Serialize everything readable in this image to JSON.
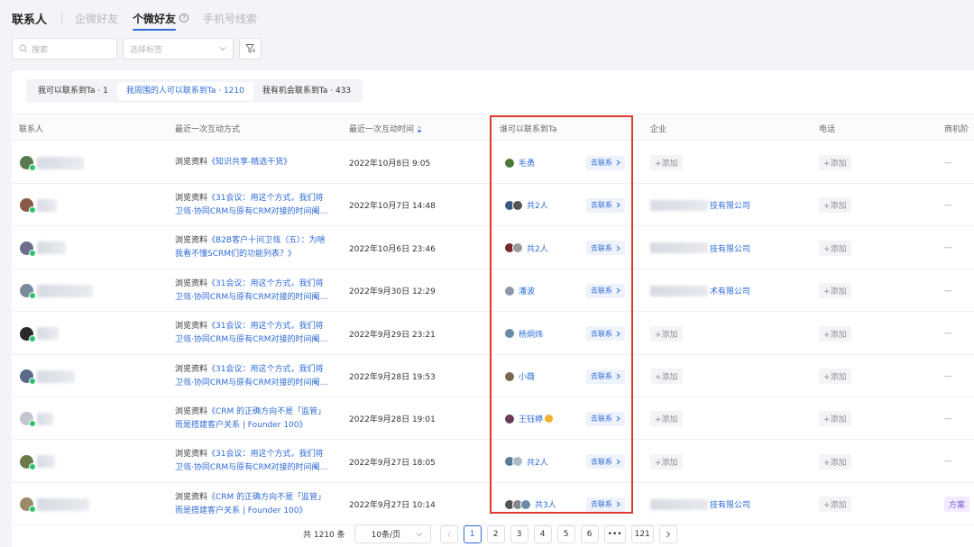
{
  "header": {
    "title": "联系人",
    "tabs": [
      {
        "label": "企微好友"
      },
      {
        "label": "个微好友"
      },
      {
        "label": "手机号线索"
      }
    ],
    "help_icon": "?"
  },
  "filters": {
    "search_placeholder": "搜索",
    "tag_placeholder": "选择标签"
  },
  "segments": [
    {
      "label": "我可以联系到Ta · 1"
    },
    {
      "label": "我周围的人可以联系到Ta · 1210"
    },
    {
      "label": "我有机会联系到Ta · 433"
    }
  ],
  "columns": {
    "contact": "联系人",
    "interaction": "最近一次互动方式",
    "time": "最近一次互动时间",
    "reach": "谁可以联系到Ta",
    "company": "企业",
    "phone": "电话",
    "stage": "商机阶"
  },
  "labels": {
    "contact_button": "去联系",
    "add": "+添加",
    "dash": "—",
    "browse_prefix": "浏览资料"
  },
  "rows": [
    {
      "line1": "《知识共享-精选干货》",
      "line2": "",
      "time": "2022年10月8日 9:05",
      "reach": "毛勇",
      "company": "",
      "stage": "—"
    },
    {
      "line1": "《31会议：用这个方式，我们将",
      "line2": "卫瓴·协同CRM与原有CRM对接的时间阉…",
      "time": "2022年10月7日 14:48",
      "reach": "共2人",
      "company": "技有限公司",
      "stage": "—"
    },
    {
      "line1": "《B2B客户十问卫瓴（五）：为啥",
      "line2": "我看不懂SCRM们的功能列表？》",
      "time": "2022年10月6日 23:46",
      "reach": "共2人",
      "company": "技有限公司",
      "stage": "—"
    },
    {
      "line1": "《31会议：用这个方式，我们将",
      "line2": "卫瓴·协同CRM与原有CRM对接的时间阉…",
      "time": "2022年9月30日 12:29",
      "reach": "潘波",
      "company": "术有限公司",
      "stage": "—"
    },
    {
      "line1": "《31会议：用这个方式，我们将",
      "line2": "卫瓴·协同CRM与原有CRM对接的时间阉…",
      "time": "2022年9月29日 23:21",
      "reach": "杨炯炜",
      "company": "",
      "stage": "—"
    },
    {
      "line1": "《31会议：用这个方式，我们将",
      "line2": "卫瓴·协同CRM与原有CRM对接的时间阉…",
      "time": "2022年9月28日 19:53",
      "reach": "小薇",
      "company": "",
      "stage": "—"
    },
    {
      "line1": "《CRM 的正确方向不是「监管」",
      "line2": "而是搭建客户关系 | Founder 100》",
      "time": "2022年9月28日 19:01",
      "reach": "王钰婷",
      "company": "",
      "stage": "—"
    },
    {
      "line1": "《31会议：用这个方式，我们将",
      "line2": "卫瓴·协同CRM与原有CRM对接的时间阉…",
      "time": "2022年9月27日 18:05",
      "reach": "共2人",
      "company": "",
      "stage": "—"
    },
    {
      "line1": "《CRM 的正确方向不是「监管」",
      "line2": "而是搭建客户关系 | Founder 100》",
      "time": "2022年9月27日 10:14",
      "reach": "共3人",
      "company": "技有限公司",
      "stage": "方案"
    }
  ],
  "pagination": {
    "total": "共 1210 条",
    "page_size": "10条/页",
    "pages": [
      "1",
      "2",
      "3",
      "4",
      "5",
      "6",
      "•••",
      "121"
    ]
  },
  "colors": {
    "accent": "#2e6bd6",
    "highlight": "#e03a2f",
    "wechat_green": "#2bc26b"
  }
}
